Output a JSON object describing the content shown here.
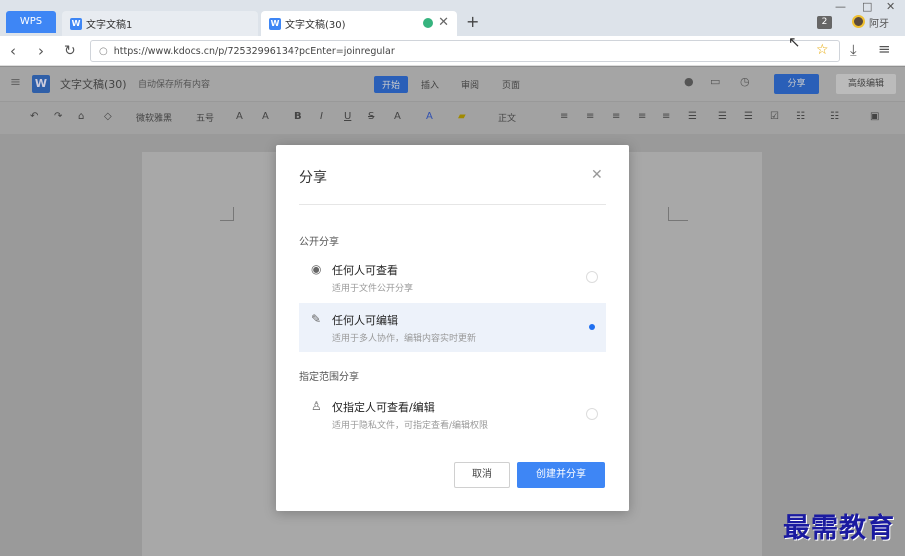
{
  "browser": {
    "wps_tab": "WPS",
    "tabs": [
      {
        "label": "文字文稿1"
      },
      {
        "label": "文字文稿(30)"
      }
    ],
    "new_tab": "+",
    "tab_count": "2",
    "user_name": "阿牙",
    "url": "https://www.kdocs.cn/p/72532996134?pcEnter=joinregular"
  },
  "app": {
    "doc_title": "文字文稿(30)",
    "autosave": "自动保存所有内容",
    "menu_tabs": [
      "开始",
      "插入",
      "审阅",
      "页面"
    ],
    "share_label": "分享",
    "advanced_edit_label": "高级编辑",
    "font_name": "微软雅黑",
    "font_size": "五号",
    "style_name": "正文"
  },
  "dialog": {
    "title": "分享",
    "public_section": "公开分享",
    "options": [
      {
        "name": "任何人可查看",
        "desc": "适用于文件公开分享",
        "icon": "eye-icon",
        "selected": false
      },
      {
        "name": "任何人可编辑",
        "desc": "适用于多人协作，编辑内容实时更新",
        "icon": "pencil-icon",
        "selected": true
      }
    ],
    "scoped_section": "指定范围分享",
    "scoped_option": {
      "name": "仅指定人可查看/编辑",
      "desc": "适用于隐私文件，可指定查看/编辑权限",
      "icon": "user-icon",
      "selected": false
    },
    "cancel_label": "取消",
    "create_label": "创建并分享"
  },
  "watermark": "最需教育",
  "colors": {
    "accent": "#3e86f5",
    "selected_bg": "#edf2fa"
  }
}
